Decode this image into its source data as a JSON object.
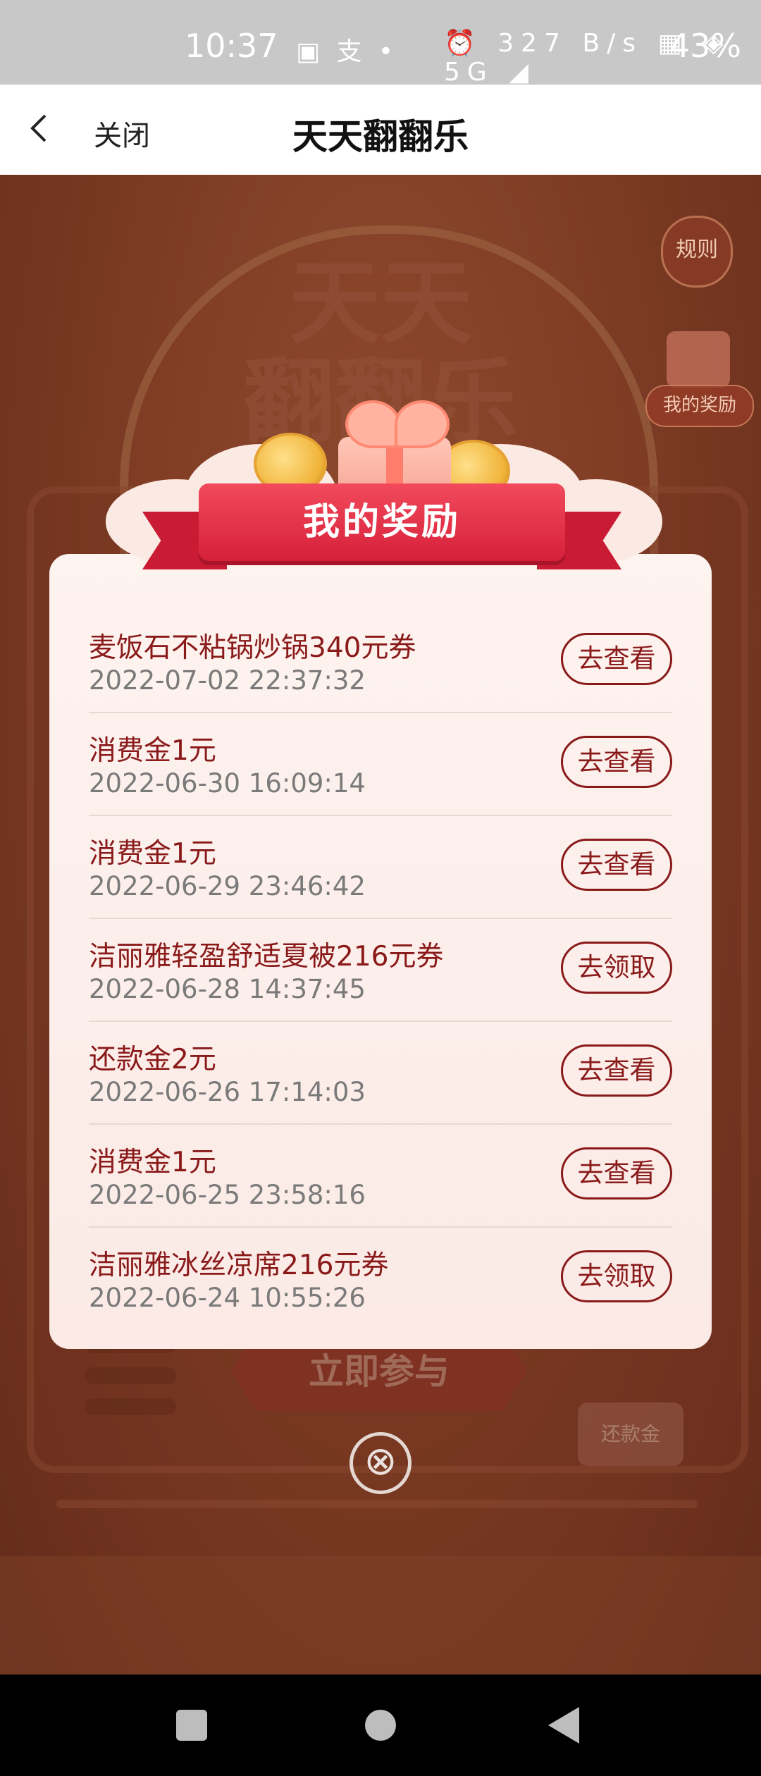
{
  "status_bar": {
    "time": "10:37",
    "left_icons": "▣ 支 •",
    "mid_icons": "⏰ 327 B/s ▦ ◈ 5G ◢",
    "battery": "43%"
  },
  "nav": {
    "close_label": "关闭",
    "title": "天天翻翻乐"
  },
  "background": {
    "title_line1": "天天",
    "title_line2": "翻翻乐",
    "rules_label": "规则",
    "my_rewards_label": "我的奖励",
    "join_label": "立即参与",
    "ticket_label": "还款金"
  },
  "modal": {
    "title": "我的奖励",
    "rewards": [
      {
        "name": "麦饭石不粘锅炒锅340元券",
        "time": "2022-07-02 22:37:32",
        "action": "去查看"
      },
      {
        "name": "消费金1元",
        "time": "2022-06-30 16:09:14",
        "action": "去查看"
      },
      {
        "name": "消费金1元",
        "time": "2022-06-29 23:46:42",
        "action": "去查看"
      },
      {
        "name": "洁丽雅轻盈舒适夏被216元券",
        "time": "2022-06-28 14:37:45",
        "action": "去领取"
      },
      {
        "name": "还款金2元",
        "time": "2022-06-26 17:14:03",
        "action": "去查看"
      },
      {
        "name": "消费金1元",
        "time": "2022-06-25 23:58:16",
        "action": "去查看"
      },
      {
        "name": "洁丽雅冰丝凉席216元券",
        "time": "2022-06-24 10:55:26",
        "action": "去领取"
      }
    ],
    "close_icon": "⊗"
  },
  "colors": {
    "accent_red": "#d6203a",
    "text_dark_red": "#8a1a1a",
    "modal_bg": "#fdf3ef"
  }
}
